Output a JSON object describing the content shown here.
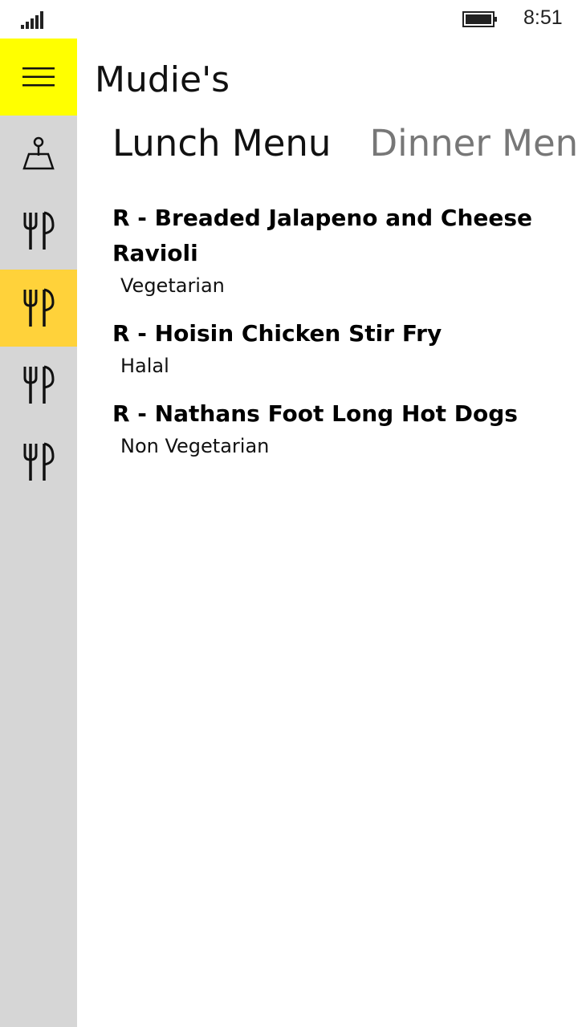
{
  "status_bar": {
    "time": "8:51",
    "icons": [
      "signal-icon",
      "battery-icon"
    ]
  },
  "header": {
    "title": "Mudie's"
  },
  "sidebar": {
    "menu_icon": "hamburger-icon",
    "items": [
      {
        "icon": "location-pin-icon",
        "selected": false
      },
      {
        "icon": "fork-knife-icon",
        "selected": false
      },
      {
        "icon": "fork-knife-icon",
        "selected": true
      },
      {
        "icon": "fork-knife-icon",
        "selected": false
      },
      {
        "icon": "fork-knife-icon",
        "selected": false
      }
    ],
    "accent_color": "#ffff00",
    "selected_color": "#ffd23a",
    "background_color": "#d6d6d6"
  },
  "tabs": [
    {
      "label": "Lunch Menu",
      "active": true
    },
    {
      "label": "Dinner Menu",
      "active": false
    }
  ],
  "menu": {
    "items": [
      {
        "name": "R - Breaded Jalapeno and Cheese Ravioli",
        "tag": "Vegetarian"
      },
      {
        "name": "R - Hoisin Chicken Stir Fry",
        "tag": "Halal"
      },
      {
        "name": "R - Nathans Foot Long Hot Dogs",
        "tag": "Non Vegetarian"
      }
    ]
  }
}
